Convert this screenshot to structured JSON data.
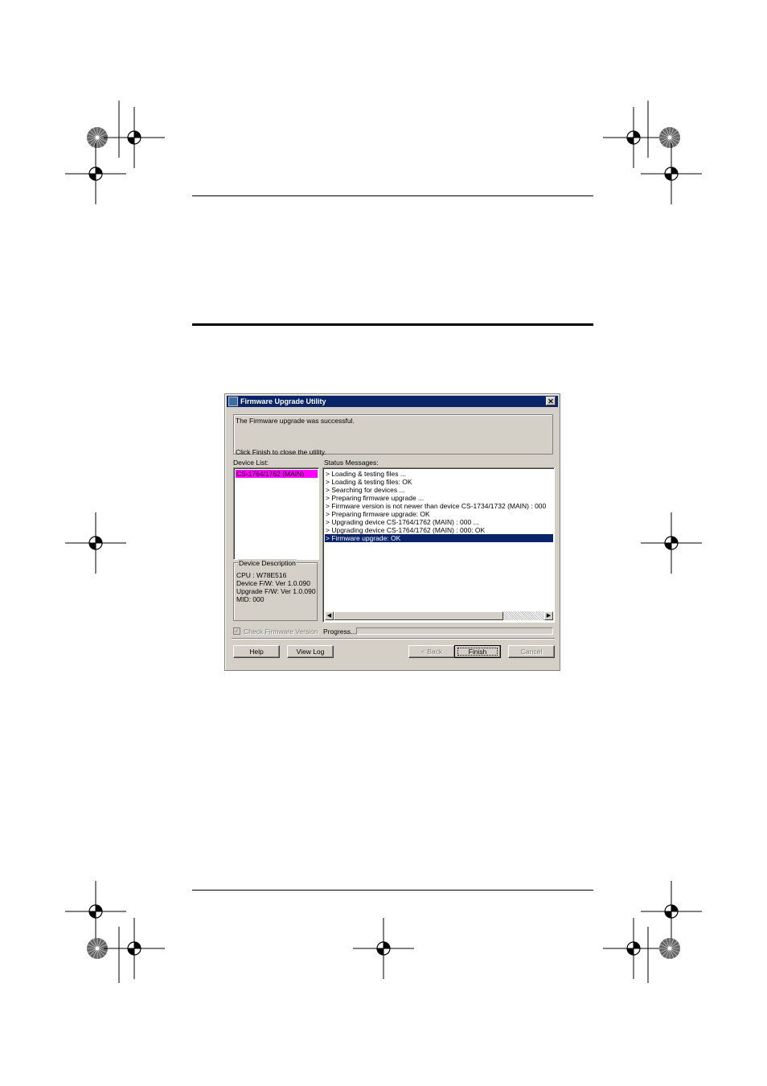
{
  "dialog": {
    "title": "Firmware Upgrade Utility",
    "close_glyph": "✕",
    "message_line1": "The Firmware upgrade was successful.",
    "message_line2": "Click Finish to close the utility.",
    "device_list_label": "Device List:",
    "device_list": [
      {
        "label": "CS-1764/1762 (MAIN)",
        "highlight_color": "#ff00ff"
      }
    ],
    "device_description": {
      "legend": "Device Description",
      "lines": [
        "CPU : W78E516",
        "Device F/W: Ver 1.0.090",
        "Upgrade F/W: Ver 1.0.090",
        "MID: 000"
      ]
    },
    "status_label": "Status Messages:",
    "status_messages": [
      "> Loading & testing files ...",
      "> Loading & testing files: OK",
      "> Searching for devices ...",
      "> Preparing firmware upgrade ...",
      "> Firmware version is not newer than device CS-1734/1732 (MAIN) : 000",
      "> Preparing firmware upgrade: OK",
      "> Upgrading device CS-1764/1762 (MAIN) : 000 ...",
      "> Upgrading device CS-1764/1762 (MAIN) : 000: OK",
      "> Firmware upgrade: OK"
    ],
    "selected_status_index": 8,
    "check_firmware_label": "Check Firmware Version",
    "check_firmware_checked": true,
    "progress_label": "Progress...",
    "buttons": {
      "help": "Help",
      "view_log": "View Log",
      "back": "< Back",
      "finish": "Finish",
      "cancel": "Cancel"
    },
    "colors": {
      "title_bar": "#0a246a",
      "selection": "#0a246a",
      "face": "#d4d0c8"
    }
  }
}
